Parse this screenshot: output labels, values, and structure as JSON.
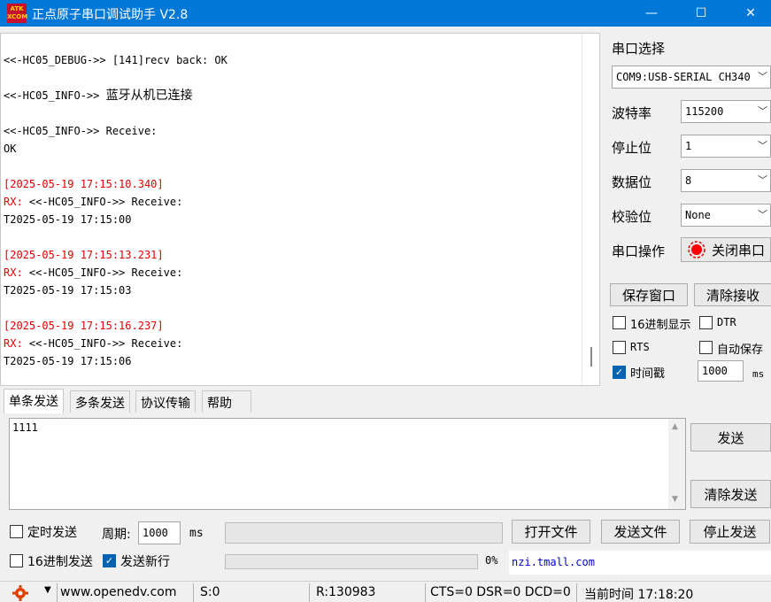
{
  "window": {
    "title": "正点原子串口调试助手 V2.8",
    "logo_text_1": "ATK",
    "logo_text_2": "XCOM",
    "minimize": "—",
    "maximize": "☐",
    "close": "✕"
  },
  "receive": {
    "lines": [
      {
        "text": "<<-HC05_DEBUG->> [141]recv back: OK",
        "color": "black"
      },
      {
        "text": "",
        "color": "black"
      },
      {
        "text": "<<-HC05_INFO->> 蓝牙从机已连接",
        "color": "black"
      },
      {
        "text": "",
        "color": "black"
      },
      {
        "text": "<<-HC05_INFO->> Receive:",
        "color": "black"
      },
      {
        "text": "OK",
        "color": "black"
      },
      {
        "text": "",
        "color": "black"
      },
      {
        "text": "[2025-05-19 17:15:10.340]",
        "color": "red"
      },
      {
        "prefix": "RX: ",
        "text": "<<-HC05_INFO->> Receive:",
        "color": "mixed"
      },
      {
        "text": "T2025-05-19 17:15:00",
        "color": "black"
      },
      {
        "text": "",
        "color": "black"
      },
      {
        "text": "[2025-05-19 17:15:13.231]",
        "color": "red"
      },
      {
        "prefix": "RX: ",
        "text": "<<-HC05_INFO->> Receive:",
        "color": "mixed"
      },
      {
        "text": "T2025-05-19 17:15:03",
        "color": "black"
      },
      {
        "text": "",
        "color": "black"
      },
      {
        "text": "[2025-05-19 17:15:16.237]",
        "color": "red"
      },
      {
        "prefix": "RX: ",
        "text": "<<-HC05_INFO->> Receive:",
        "color": "mixed"
      },
      {
        "text": "T2025-05-19 17:15:06",
        "color": "black"
      }
    ]
  },
  "settings": {
    "port_select_label": "串口选择",
    "port_value": "COM9:USB-SERIAL CH340",
    "baud_label": "波特率",
    "baud_value": "115200",
    "stop_label": "停止位",
    "stop_value": "1",
    "data_label": "数据位",
    "data_value": "8",
    "parity_label": "校验位",
    "parity_value": "None",
    "port_op_label": "串口操作",
    "port_op_button": "关闭串口",
    "save_window": "保存窗口",
    "clear_recv": "清除接收",
    "hex_display": "16进制显示",
    "dtr": "DTR",
    "rts": "RTS",
    "auto_save": "自动保存",
    "timestamp": "时间戳",
    "timestamp_value": "1000",
    "timestamp_unit": "ms"
  },
  "tabs": [
    "单条发送",
    "多条发送",
    "协议传输",
    "帮助"
  ],
  "send": {
    "text": "1111",
    "send_button": "发送",
    "clear_send_button": "清除发送",
    "timed_send": "定时发送",
    "period_label": "周期:",
    "period_value": "1000",
    "period_unit": "ms",
    "open_file": "打开文件",
    "send_file": "发送文件",
    "stop_send": "停止发送",
    "hex_send": "16进制发送",
    "send_newline": "发送新行",
    "progress_percent": "0%",
    "progress_fraction": 0,
    "link": "nzi.tmall.com"
  },
  "status": {
    "website": "www.openedv.com",
    "sent": "S:0",
    "received": "R:130983",
    "lines": "CTS=0 DSR=0 DCD=0",
    "time": "当前时间 17:18:20"
  }
}
